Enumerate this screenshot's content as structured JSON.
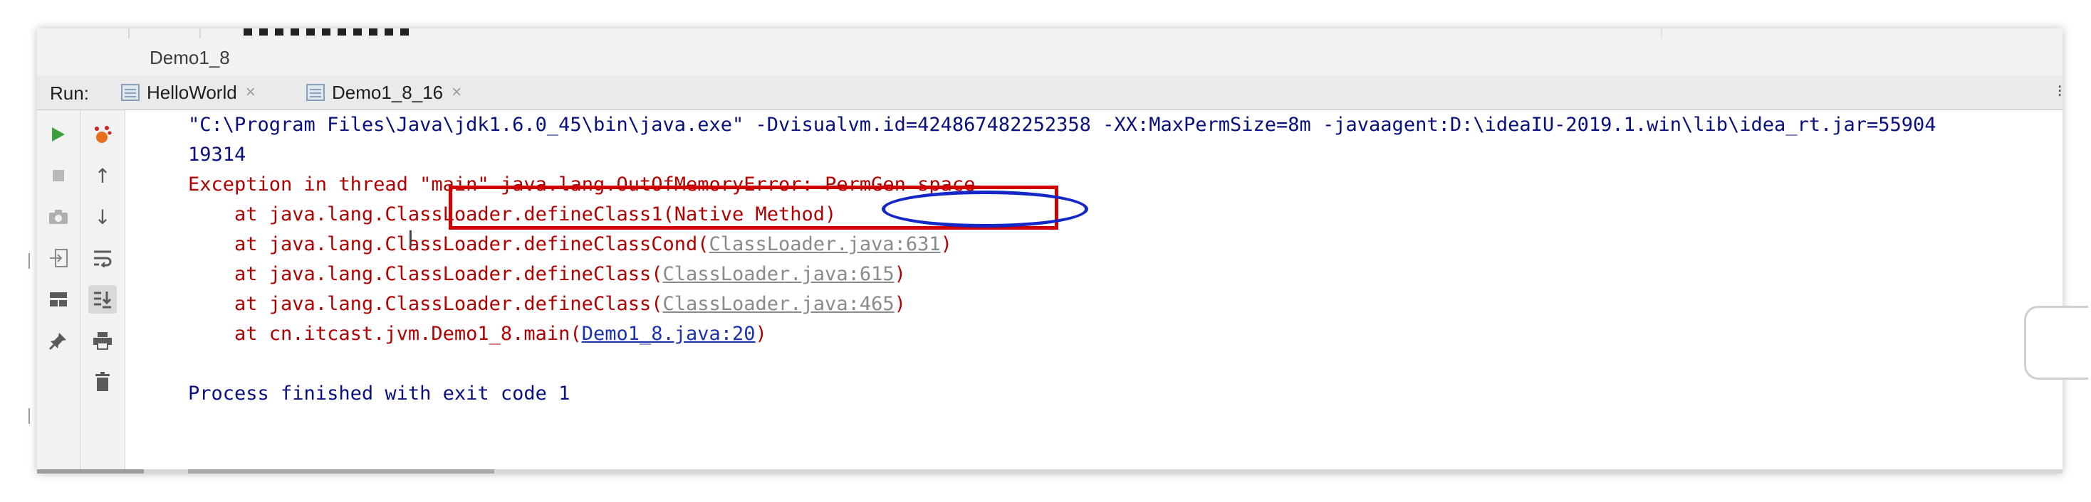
{
  "window": {
    "title": "Demo1_8"
  },
  "run_panel": {
    "label": "Run:",
    "tabs": [
      {
        "label": "HelloWorld",
        "close": "×"
      },
      {
        "label": "Demo1_8_16",
        "close": "×"
      }
    ]
  },
  "toolbar_icons": [
    "run-icon",
    "stop-icon",
    "camera-icon",
    "login-icon",
    "layout-icon",
    "pin-icon",
    "debug-icon",
    "arrow-up-icon",
    "arrow-down-icon",
    "soft-wrap-icon",
    "scroll-to-end-icon",
    "print-icon",
    "trash-icon"
  ],
  "console": {
    "command_line": "\"C:\\Program Files\\Java\\jdk1.6.0_45\\bin\\java.exe\" -Dvisualvm.id=424867482252358 -XX:MaxPermSize=8m -javaagent:D:\\ideaIU-2019.1.win\\lib\\idea_rt.jar=55904",
    "count_output": "19314",
    "exception_prefix": "Exception in thread \"main\" ",
    "exception_class": "java.lang.OutOfMemoryError:",
    "exception_message": " PermGen space",
    "stack": [
      {
        "prefix": "    at java.lang.ClassLoader.defineClass1(Native Method)",
        "link": "",
        "suffix": ""
      },
      {
        "prefix": "    at java.lang.ClassLoader.defineClassCond(",
        "link": "ClassLoader.java:631",
        "suffix": ")"
      },
      {
        "prefix": "    at java.lang.ClassLoader.defineClass(",
        "link": "ClassLoader.java:615",
        "suffix": ")"
      },
      {
        "prefix": "    at java.lang.ClassLoader.defineClass(",
        "link": "ClassLoader.java:465",
        "suffix": ")"
      },
      {
        "prefix": "    at cn.itcast.jvm.Demo1_8.main(",
        "link": "Demo1_8.java:20",
        "suffix": ")"
      }
    ],
    "exit_message": "Process finished with exit code 1"
  },
  "colors": {
    "error_text": "#b10000",
    "normal_text": "#081080",
    "highlight_box": "#d00000",
    "highlight_ellipse": "#1428c8",
    "link_gray": "#8a8a8a",
    "link_blue": "#1a32b0"
  }
}
